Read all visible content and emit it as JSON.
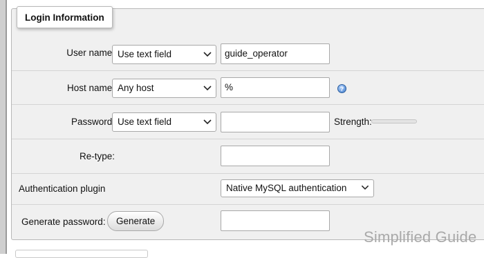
{
  "legend": "Login Information",
  "rows": {
    "username": {
      "label": "User name:",
      "mode": "Use text field",
      "value": "guide_operator"
    },
    "hostname": {
      "label": "Host name:",
      "mode": "Any host",
      "value": "%"
    },
    "password": {
      "label": "Password:",
      "mode": "Use text field",
      "value": "",
      "strength_label": "Strength:"
    },
    "retype": {
      "label": "Re-type:",
      "value": ""
    },
    "auth": {
      "label": "Authentication plugin",
      "value": "Native MySQL authentication"
    },
    "generate": {
      "label": "Generate password:",
      "button": "Generate",
      "value": ""
    }
  },
  "help_icon": "question-mark-icon",
  "watermark": "Simplified Guide"
}
